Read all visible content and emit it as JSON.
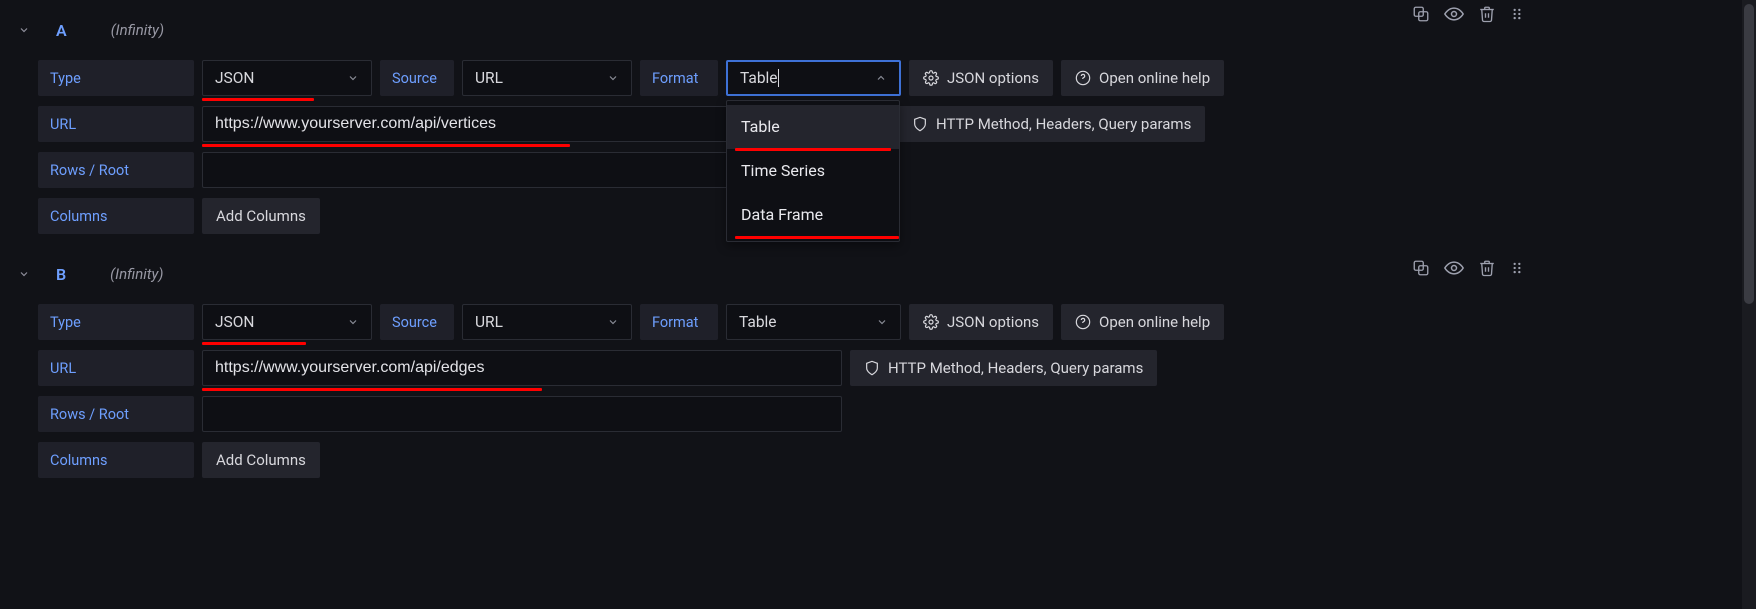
{
  "queries": {
    "a": {
      "letter": "A",
      "datasource": "(Infinity)",
      "labels": {
        "type": "Type",
        "source": "Source",
        "format": "Format",
        "url": "URL",
        "rows": "Rows / Root",
        "columns": "Columns"
      },
      "values": {
        "type": "JSON",
        "source": "URL",
        "format": "Table",
        "url": "https://www.yourserver.com/api/vertices",
        "rows": ""
      },
      "buttons": {
        "json_options": "JSON options",
        "open_help": "Open online help",
        "http_extras": "HTTP Method, Headers, Query params",
        "add_columns": "Add Columns"
      },
      "format_options": [
        "Table",
        "Time Series",
        "Data Frame"
      ]
    },
    "b": {
      "letter": "B",
      "datasource": "(Infinity)",
      "labels": {
        "type": "Type",
        "source": "Source",
        "format": "Format",
        "url": "URL",
        "rows": "Rows / Root",
        "columns": "Columns"
      },
      "values": {
        "type": "JSON",
        "source": "URL",
        "format": "Table",
        "url": "https://www.yourserver.com/api/edges",
        "rows": ""
      },
      "buttons": {
        "json_options": "JSON options",
        "open_help": "Open online help",
        "http_extras": "HTTP Method, Headers, Query params",
        "add_columns": "Add Columns"
      }
    }
  }
}
